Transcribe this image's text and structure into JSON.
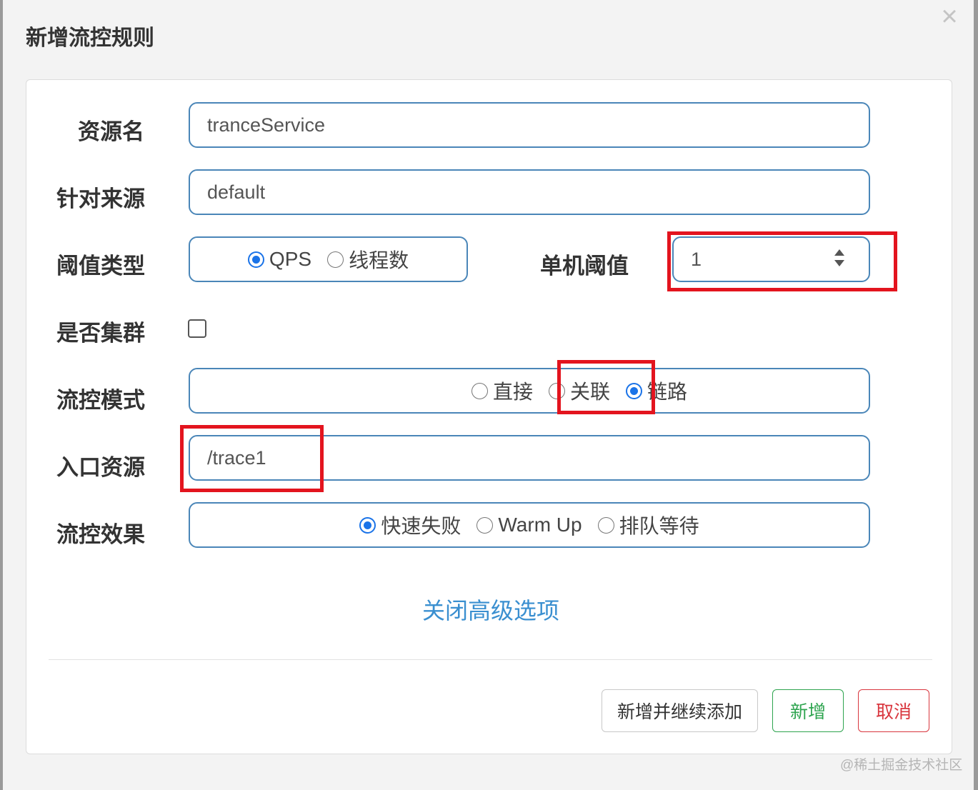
{
  "dialog": {
    "title": "新增流控规则",
    "close_icon": "close-icon"
  },
  "form": {
    "resource_name": {
      "label": "资源名",
      "value": "tranceService"
    },
    "limit_app": {
      "label": "针对来源",
      "value": "default"
    },
    "grade": {
      "label": "阈值类型",
      "options": [
        "QPS",
        "线程数"
      ],
      "selected": "QPS"
    },
    "count": {
      "label": "单机阈值",
      "value": "1"
    },
    "cluster": {
      "label": "是否集群",
      "checked": false
    },
    "strategy": {
      "label": "流控模式",
      "options": [
        "直接",
        "关联",
        "链路"
      ],
      "selected": "链路"
    },
    "ref_resource": {
      "label": "入口资源",
      "value": "/trace1"
    },
    "control_behavior": {
      "label": "流控效果",
      "options": [
        "快速失败",
        "Warm Up",
        "排队等待"
      ],
      "selected": "快速失败"
    },
    "advanced_toggle": "关闭高级选项"
  },
  "footer": {
    "continue_label": "新增并继续添加",
    "add_label": "新增",
    "cancel_label": "取消"
  },
  "colors": {
    "accent_radio": "#1a73e8",
    "input_border": "#4a86b8",
    "highlight_box": "#e3141e",
    "add_button": "#2ea44f",
    "cancel_button": "#d9363e",
    "link": "#3a8fd0"
  },
  "watermark": "@稀土掘金技术社区"
}
